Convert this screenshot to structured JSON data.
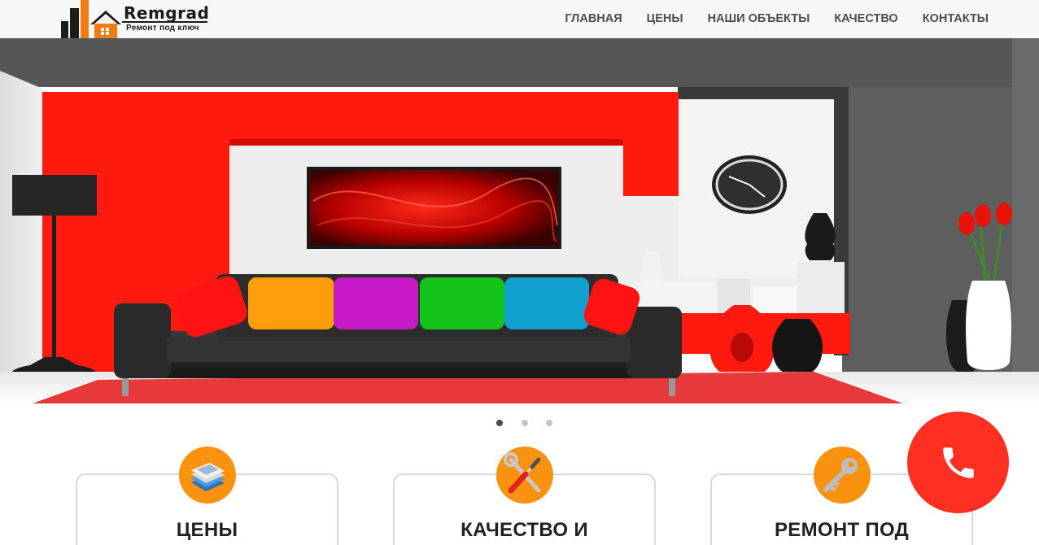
{
  "brand": {
    "name": "Remgrad",
    "tagline": "Ремонт под ключ",
    "logo_icon": "buildings-house-logo"
  },
  "nav": {
    "items": [
      {
        "label": "ГЛАВНАЯ"
      },
      {
        "label": "ЦЕНЫ"
      },
      {
        "label": "НАШИ ОБЪЕКТЫ"
      },
      {
        "label": "КАЧЕСТВО"
      },
      {
        "label": "КОНТАКТЫ"
      }
    ]
  },
  "hero": {
    "image": "living-room-interior-photo",
    "slides_total": 3,
    "active_slide": 1
  },
  "features": [
    {
      "title": "ЦЕНЫ",
      "icon": "money-stack-icon"
    },
    {
      "title": "КАЧЕСТВО И",
      "icon": "tools-icon"
    },
    {
      "title": "РЕМОНТ ПОД",
      "icon": "key-icon"
    }
  ],
  "call_button": {
    "icon": "phone-icon"
  },
  "colors": {
    "accent_orange": "#f8920f",
    "call_red": "#ff2f21",
    "nav_text": "#4e4e4e",
    "header_bg": "#f7f7f7"
  }
}
